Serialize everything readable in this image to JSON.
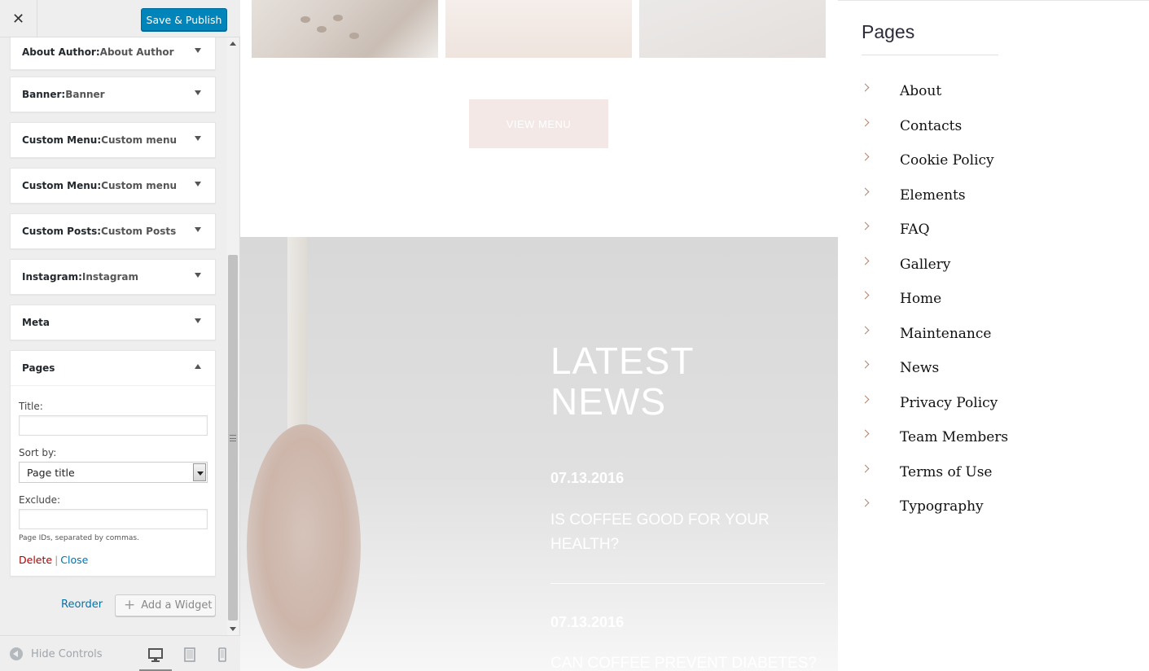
{
  "header": {
    "close_glyph": "✕",
    "save_publish": "Save & Publish"
  },
  "widgets": [
    {
      "name": "About Author",
      "title": "About Author"
    },
    {
      "name": "Banner",
      "title": "Banner"
    },
    {
      "name": "Custom Menu",
      "title": "Custom menu"
    },
    {
      "name": "Custom Menu",
      "title": "Custom menu"
    },
    {
      "name": "Custom Posts",
      "title": "Custom Posts"
    },
    {
      "name": "Instagram",
      "title": "Instagram"
    },
    {
      "name": "Meta",
      "title": ""
    },
    {
      "name": "Pages",
      "title": ""
    }
  ],
  "pages_form": {
    "title_label": "Title:",
    "title_value": "",
    "sort_label": "Sort by:",
    "sort_value": "Page title",
    "exclude_label": "Exclude:",
    "exclude_value": "",
    "hint": "Page IDs, separated by commas.",
    "delete": "Delete",
    "separator": "|",
    "close": "Close"
  },
  "bottom_actions": {
    "reorder": "Reorder",
    "add_widget": "Add a Widget"
  },
  "footer": {
    "hide_controls": "Hide Controls",
    "devices": [
      "desktop-icon",
      "tablet-icon",
      "mobile-icon"
    ],
    "active_device": "desktop"
  },
  "preview": {
    "view_menu": "VIEW MENU",
    "news_title_line1": "LATEST",
    "news_title_line2": "NEWS",
    "news": [
      {
        "date": "07.13.2016",
        "headline": "IS COFFEE GOOD FOR YOUR HEALTH?"
      },
      {
        "date": "07.13.2016",
        "headline": "CAN COFFEE PREVENT DIABETES?"
      }
    ],
    "pages_widget": {
      "title": "Pages",
      "items": [
        "About",
        "Contacts",
        "Cookie Policy",
        "Elements",
        "FAQ",
        "Gallery",
        "Home",
        "Maintenance",
        "News",
        "Privacy Policy",
        "Team Members",
        "Terms of Use",
        "Typography"
      ]
    }
  },
  "colors": {
    "primary_button": "#0085ba",
    "link": "#0073aa",
    "delete_link": "#aa0000",
    "chevron": "#b2826e"
  }
}
